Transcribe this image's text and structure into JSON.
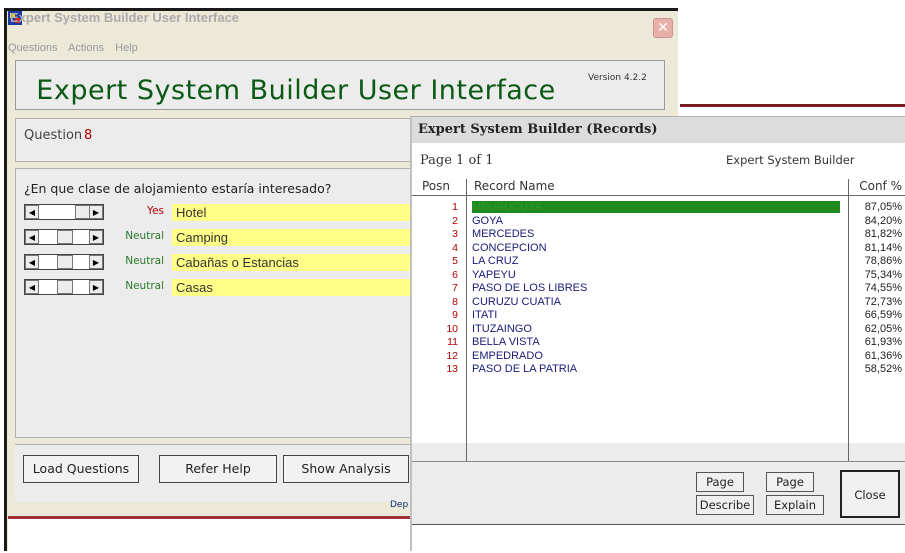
{
  "main_window": {
    "title": "Expert System Builder User Interface",
    "close_glyph": "✕",
    "menu": [
      "Questions",
      "Actions",
      "Help"
    ],
    "banner_title": "Expert System Builder User Interface",
    "version": "Version 4.2.2",
    "question_label": "Question",
    "question_number": "8",
    "question_text": "¿En que clase de alojamiento estaría interesado?",
    "answers": [
      {
        "status": "Yes",
        "label": "Hotel"
      },
      {
        "status": "Neutral",
        "label": "Camping"
      },
      {
        "status": "Neutral",
        "label": "Cabañas o Estancias"
      },
      {
        "status": "Neutral",
        "label": "Casas"
      }
    ],
    "buttons": {
      "load": "Load Questions",
      "help": "Refer Help",
      "analysis": "Show Analysis"
    },
    "footer_text": "Dep"
  },
  "records_window": {
    "title": "Expert System Builder (Records)",
    "page_info": "Page 1 of 1",
    "brand": "Expert System Builder",
    "columns": {
      "posn": "Posn",
      "name": "Record Name",
      "conf": "Conf %"
    },
    "records": [
      {
        "posn": "1",
        "name": "MBURUCUYA",
        "conf": "87,05%"
      },
      {
        "posn": "2",
        "name": "GOYA",
        "conf": "84,20%"
      },
      {
        "posn": "3",
        "name": "MERCEDES",
        "conf": "81,82%"
      },
      {
        "posn": "4",
        "name": "CONCEPCION",
        "conf": "81,14%"
      },
      {
        "posn": "5",
        "name": "LA CRUZ",
        "conf": "78,86%"
      },
      {
        "posn": "6",
        "name": "YAPEYU",
        "conf": "75,34%"
      },
      {
        "posn": "7",
        "name": "PASO DE LOS LIBRES",
        "conf": "74,55%"
      },
      {
        "posn": "8",
        "name": "CURUZU CUATIA",
        "conf": "72,73%"
      },
      {
        "posn": "9",
        "name": "ITATI",
        "conf": "66,59%"
      },
      {
        "posn": "10",
        "name": "ITUZAINGO",
        "conf": "62,05%"
      },
      {
        "posn": "11",
        "name": "BELLA VISTA",
        "conf": "61,93%"
      },
      {
        "posn": "12",
        "name": "EMPEDRADO",
        "conf": "61,36%"
      },
      {
        "posn": "13",
        "name": "PASO DE LA PATRIA",
        "conf": "58,52%"
      }
    ],
    "buttons": {
      "page_prev": "Page <<",
      "page_next": "Page >>",
      "describe": "Describe",
      "explain": "Explain",
      "close": "Close"
    }
  },
  "colors": {
    "title_green": "#0a5a14",
    "yes": "#b00000",
    "neutral": "#2a7a2a",
    "selected_row": "#1e8a1e",
    "answer_field": "#ffff88"
  }
}
